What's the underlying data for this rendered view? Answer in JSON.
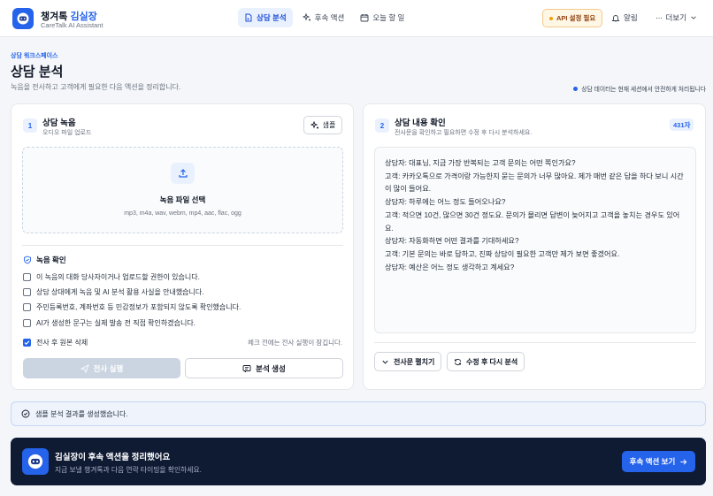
{
  "app": {
    "brand_prefix": "챙겨톡",
    "brand_accent": "김실장",
    "brand_sub": "CareTalk AI Assistant"
  },
  "nav": {
    "items": [
      {
        "label": "상담 분석",
        "icon": "document-audio-icon",
        "active": true
      },
      {
        "label": "후속 액션",
        "icon": "sparkle-icon",
        "active": false
      },
      {
        "label": "오늘 할 일",
        "icon": "calendar-icon",
        "active": false
      }
    ]
  },
  "header": {
    "api_badge": "API 설정 필요",
    "alerts_label": "알림",
    "more_label": "더보기"
  },
  "page": {
    "crumb": "상담 워크스페이스",
    "title": "상담 분석",
    "description": "녹음을 전사하고 고객에게 필요한 다음 액션을 정리합니다.",
    "secure_note": "상담 데이터는 현재 세션에서 안전하게 처리됩니다"
  },
  "left_panel": {
    "step": "1",
    "title": "상담 녹음",
    "subtitle": "오디오 파일 업로드",
    "sample_label": "샘플",
    "upload_title": "녹음 파일 선택",
    "upload_formats": "mp3, m4a, wav, webm, mp4, aac, flac, ogg",
    "consent_title": "녹음 확인",
    "checks": [
      {
        "label": "이 녹음의 대화 당사자이거나 업로드할 권한이 있습니다.",
        "checked": false
      },
      {
        "label": "상담 상대에게 녹음 및 AI 분석 활용 사실을 안내했습니다.",
        "checked": false
      },
      {
        "label": "주민등록번호, 계좌번호 등 민감정보가 포함되지 않도록 확인했습니다.",
        "checked": false
      },
      {
        "label": "AI가 생성한 문구는 실제 발송 전 직접 확인하겠습니다.",
        "checked": false
      },
      {
        "label": "전사 후 원본 삭제",
        "checked": true
      }
    ],
    "check_hint": "체크 전에는 전사 실행이 잠깁니다.",
    "transcribe_label": "전사 실행",
    "generate_label": "분석 생성"
  },
  "right_panel": {
    "step": "2",
    "title": "상담 내용 확인",
    "subtitle": "전사문을 확인하고 필요하면 수정 후 다시 분석하세요.",
    "char_count": "431자",
    "transcript": [
      "상담자: 대표님, 지금 가장 반복되는 고객 문의는 어떤 쪽인가요?",
      "고객: 카카오톡으로 가격이랑 가능한지 묻는 문의가 너무 많아요. 제가 매번 같은 답을 하다 보니 시간",
      "이 많이 들어요.",
      "상담자: 하루에는 어느 정도 들어오나요?",
      "고객: 적으면 10건, 많으면 30건 정도요. 문의가 몰리면 답변이 늦어지고 고객을 놓치는 경우도 있어",
      "요.",
      "상담자: 자동화하면 어떤 결과를 기대하세요?",
      "고객: 기본 문의는 바로 답하고, 진짜 상담이 필요한 고객만 제가 보면 좋겠어요.",
      "상담자: 예산은 어느 정도 생각하고 계세요?"
    ],
    "expand_label": "전사문 펼치기",
    "reanalyze_label": "수정 후 다시 분석"
  },
  "status": {
    "message": "샘플 분석 결과를 생성했습니다."
  },
  "banner": {
    "title": "김실장이 후속 액션을 정리했어요",
    "subtitle": "지금 보낼 챙겨톡과 다음 연락 타이밍을 확인하세요.",
    "button_label": "후속 액션 보기"
  }
}
